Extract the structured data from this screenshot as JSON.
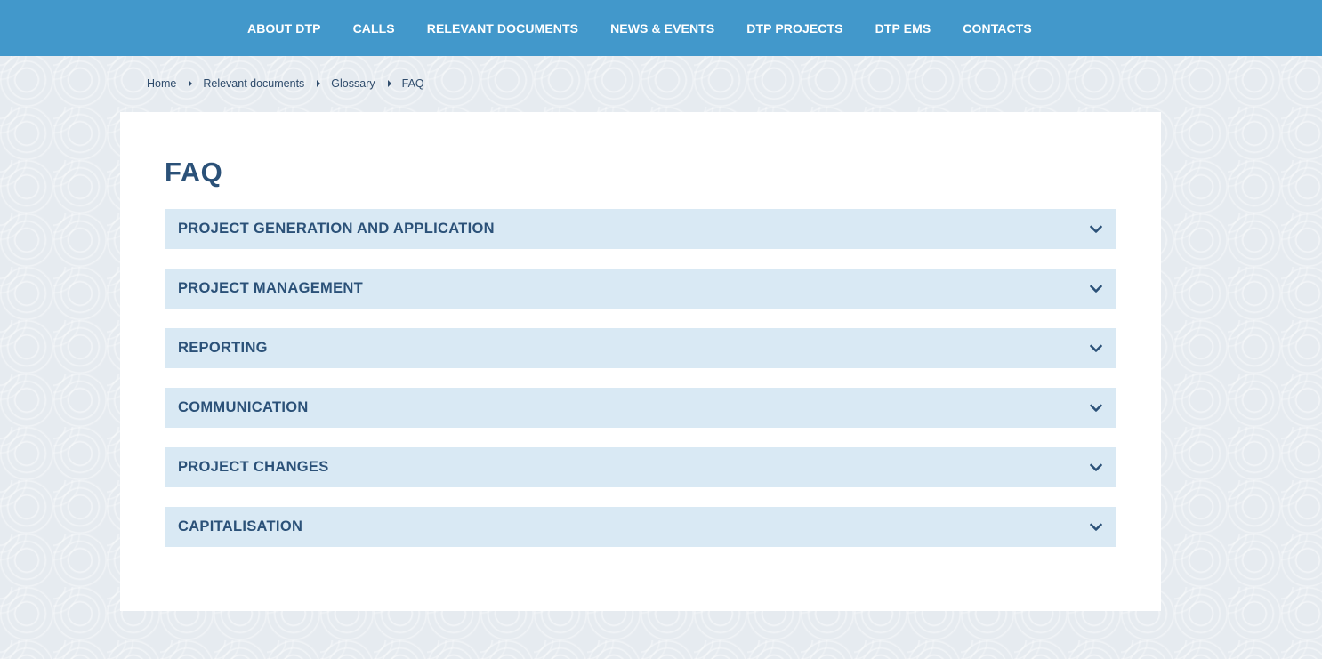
{
  "nav": {
    "items": [
      {
        "label": "ABOUT DTP"
      },
      {
        "label": "CALLS"
      },
      {
        "label": "RELEVANT DOCUMENTS"
      },
      {
        "label": "NEWS & EVENTS"
      },
      {
        "label": "DTP PROJECTS"
      },
      {
        "label": "DTP EMS"
      },
      {
        "label": "CONTACTS"
      }
    ]
  },
  "breadcrumb": {
    "items": [
      {
        "label": "Home"
      },
      {
        "label": "Relevant documents"
      },
      {
        "label": "Glossary"
      },
      {
        "label": "FAQ"
      }
    ]
  },
  "page": {
    "title": "FAQ"
  },
  "accordion": {
    "items": [
      {
        "label": "PROJECT GENERATION AND APPLICATION",
        "icon": "chevron-down-icon"
      },
      {
        "label": "PROJECT MANAGEMENT",
        "icon": "chevron-down-icon"
      },
      {
        "label": "REPORTING",
        "icon": "chevron-down-icon"
      },
      {
        "label": "COMMUNICATION",
        "icon": "chevron-down-icon"
      },
      {
        "label": "PROJECT CHANGES",
        "icon": "chevron-down-icon"
      },
      {
        "label": "CAPITALISATION",
        "icon": "chevron-down-icon"
      }
    ]
  },
  "colors": {
    "nav_bg": "#4298cb",
    "heading": "#2b5178",
    "accordion_bg": "#d9e9f4",
    "page_bg": "#e6ebf0"
  }
}
